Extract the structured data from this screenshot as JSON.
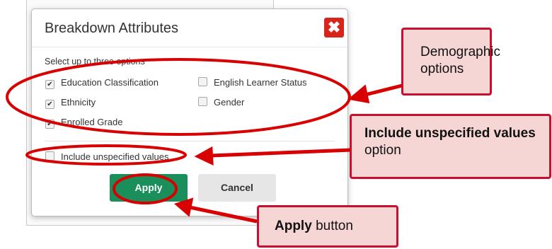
{
  "dialog": {
    "title": "Breakdown Attributes",
    "close_icon": "close-x-icon",
    "instruction": "Select up to three options",
    "options": [
      {
        "label": "Education Classification",
        "checked": true
      },
      {
        "label": "English Learner Status",
        "checked": false
      },
      {
        "label": "Ethnicity",
        "checked": true
      },
      {
        "label": "Gender",
        "checked": false
      },
      {
        "label": "Enrolled Grade",
        "checked": true
      }
    ],
    "include_unspecified": {
      "label": "Include unspecified values",
      "checked": false
    },
    "apply_label": "Apply",
    "cancel_label": "Cancel"
  },
  "callouts": {
    "demographic": "Demographic options",
    "unspecified_bold": "Include unspecified values",
    "unspecified_rest": "option",
    "apply_bold": "Apply",
    "apply_rest": "button"
  },
  "colors": {
    "annotation_red": "#d80000",
    "callout_fill": "#f6d5d5",
    "callout_border": "#c8102e",
    "apply_green": "#1a8f5b",
    "close_red": "#d9241c"
  }
}
